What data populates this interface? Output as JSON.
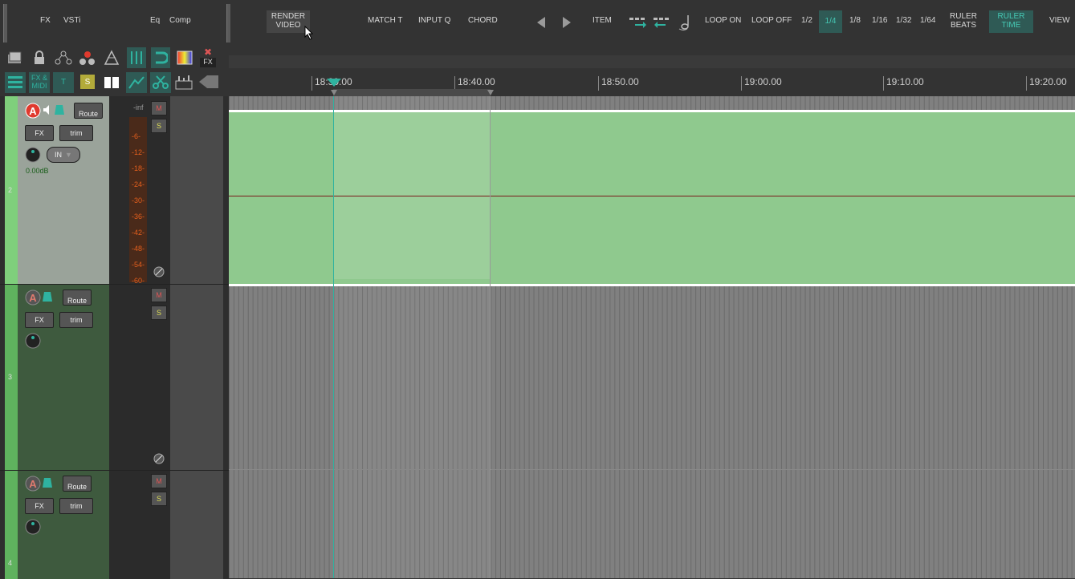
{
  "toolbar": {
    "fx": "FX",
    "vsti": "VSTi",
    "eq": "Eq",
    "comp": "Comp",
    "render_video_line1": "RENDER",
    "render_video_line2": "VIDEO",
    "match_t": "MATCH T",
    "input_q": "INPUT Q",
    "chord": "CHORD",
    "item": "ITEM",
    "loop_on": "LOOP ON",
    "loop_off": "LOOP OFF",
    "grid_half": "1/2",
    "grid_quarter": "1/4",
    "grid_eighth": "1/8",
    "grid_16": "1/16",
    "grid_32": "1/32",
    "grid_64": "1/64",
    "ruler_beats_1": "RULER",
    "ruler_beats_2": "BEATS",
    "ruler_time_1": "RULER",
    "ruler_time_2": "TIME",
    "view": "VIEW"
  },
  "toolbar2": {
    "fx_midi_1": "FX &",
    "fx_midi_2": "MIDI",
    "t": "T",
    "s": "S",
    "fx_remove": "FX"
  },
  "ruler": {
    "labels": [
      "18:30.00",
      "18:40.00",
      "18:50.00",
      "19:00.00",
      "19:10.00",
      "19:20.00"
    ]
  },
  "tracks": [
    {
      "number": "2",
      "route": "Route",
      "fx": "FX",
      "trim": "trim",
      "in": "IN",
      "volume": "0.00dB",
      "mute": "M",
      "solo": "S",
      "meter_top": "-inf",
      "meter_scale": [
        "-6-",
        "-12-",
        "-18-",
        "-24-",
        "-30-",
        "-36-",
        "-42-",
        "-48-",
        "-54-",
        "-60-"
      ]
    },
    {
      "number": "3",
      "route": "Route",
      "fx": "FX",
      "trim": "trim",
      "mute": "M",
      "solo": "S"
    },
    {
      "number": "4",
      "route": "Route",
      "fx": "FX",
      "trim": "trim",
      "mute": "M",
      "solo": "S"
    }
  ],
  "colors": {
    "accent_teal": "#2fb3a0",
    "item_green": "#8fc98e",
    "track_green": "#5fb25e",
    "record_red": "#e03a2e"
  }
}
